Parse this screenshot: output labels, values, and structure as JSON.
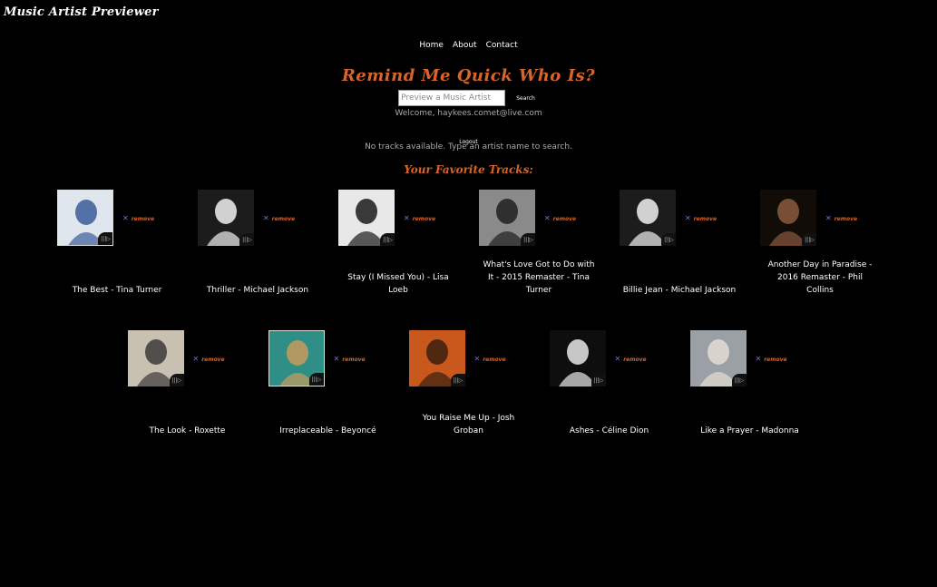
{
  "app": {
    "title": "Music Artist Previewer"
  },
  "nav": {
    "items": [
      "Home",
      "About",
      "Contact"
    ]
  },
  "main": {
    "headline": "Remind Me Quick Who Is?",
    "search_placeholder": "Preview a Music Artist",
    "search_value": "",
    "search_label": "Search",
    "welcome": "Welcome, haykees.comet@live.com",
    "logout_label": "Logout",
    "no_tracks": "No tracks available. Type an artist name to search.",
    "favorites_heading": "Your Favorite Tracks:"
  },
  "remove_label": "remove",
  "play_icon": "play-icon",
  "favorites": [
    {
      "name": "The Best - Tina Turner",
      "cover": {
        "bg": "#dfe6ee",
        "fg": "#3b5b9a"
      }
    },
    {
      "name": "Thriller - Michael Jackson",
      "cover": {
        "bg": "#1c1c1c",
        "fg": "#f1f1f1"
      }
    },
    {
      "name": "Stay (I Missed You) - Lisa Loeb",
      "cover": {
        "bg": "#e8e8e8",
        "fg": "#1a1a1a"
      }
    },
    {
      "name": "What's Love Got to Do with It - 2015 Remaster - Tina Turner",
      "cover": {
        "bg": "#8a8a8a",
        "fg": "#1f1f1f"
      }
    },
    {
      "name": "Billie Jean - Michael Jackson",
      "cover": {
        "bg": "#1c1c1c",
        "fg": "#f1f1f1"
      }
    },
    {
      "name": "Another Day in Paradise - 2016 Remaster - Phil Collins",
      "cover": {
        "bg": "#120c08",
        "fg": "#8a5a3e"
      }
    },
    {
      "name": "The Look - Roxette",
      "cover": {
        "bg": "#c8c0b0",
        "fg": "#3a3a3a"
      }
    },
    {
      "name": "Irreplaceable - Beyoncé",
      "cover": {
        "bg": "#2f8f86",
        "fg": "#c79a5c"
      }
    },
    {
      "name": "You Raise Me Up - Josh Groban",
      "cover": {
        "bg": "#c8581c",
        "fg": "#3b1e0e"
      }
    },
    {
      "name": "Ashes - Céline Dion",
      "cover": {
        "bg": "#0e0e0e",
        "fg": "#e8e8e8"
      }
    },
    {
      "name": "Like a Prayer - Madonna",
      "cover": {
        "bg": "#9aa0a6",
        "fg": "#e3ddd2"
      }
    }
  ]
}
